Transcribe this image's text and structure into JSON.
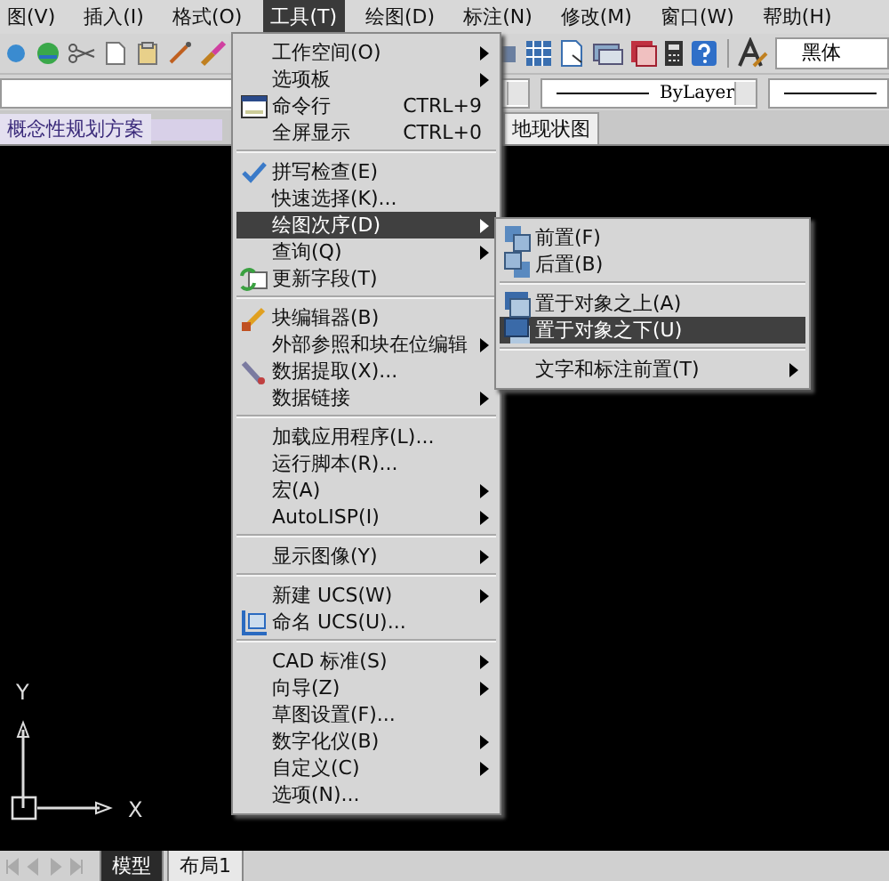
{
  "menubar": [
    {
      "label": "图(V)",
      "selected": false
    },
    {
      "label": "插入(I)",
      "selected": false
    },
    {
      "label": "格式(O)",
      "selected": false
    },
    {
      "label": "工具(T)",
      "selected": true
    },
    {
      "label": "绘图(D)",
      "selected": false
    },
    {
      "label": "标注(N)",
      "selected": false
    },
    {
      "label": "修改(M)",
      "selected": false
    },
    {
      "label": "窗口(W)",
      "selected": false
    },
    {
      "label": "帮助(H)",
      "selected": false
    }
  ],
  "font_field": {
    "value": "黑体"
  },
  "linetype_dropdown": {
    "value": "ByLayer"
  },
  "document_tabs": [
    {
      "label": "概念性规划方案",
      "selected": true
    },
    {
      "label": "地现状图",
      "selected": false
    }
  ],
  "tools_menu": [
    {
      "kind": "item",
      "label": "工作空间(O)",
      "has_submenu": true,
      "selected": false
    },
    {
      "kind": "item",
      "label": "选项板",
      "has_submenu": true,
      "selected": false
    },
    {
      "kind": "item",
      "label": "命令行",
      "shortcut": "CTRL+9",
      "has_submenu": false,
      "selected": false
    },
    {
      "kind": "item",
      "label": "全屏显示",
      "shortcut": "CTRL+0",
      "has_submenu": false,
      "selected": false
    },
    {
      "kind": "separator"
    },
    {
      "kind": "item",
      "label": "拼写检查(E)",
      "has_submenu": false,
      "selected": false
    },
    {
      "kind": "item",
      "label": "快速选择(K)...",
      "has_submenu": false,
      "selected": false
    },
    {
      "kind": "item",
      "label": "绘图次序(D)",
      "has_submenu": true,
      "selected": true
    },
    {
      "kind": "item",
      "label": "查询(Q)",
      "has_submenu": true,
      "selected": false
    },
    {
      "kind": "item",
      "label": "更新字段(T)",
      "has_submenu": false,
      "selected": false
    },
    {
      "kind": "separator"
    },
    {
      "kind": "item",
      "label": "块编辑器(B)",
      "has_submenu": false,
      "selected": false
    },
    {
      "kind": "item",
      "label": "外部参照和块在位编辑",
      "has_submenu": true,
      "selected": false
    },
    {
      "kind": "item",
      "label": "数据提取(X)...",
      "has_submenu": false,
      "selected": false
    },
    {
      "kind": "item",
      "label": "数据链接",
      "has_submenu": true,
      "selected": false
    },
    {
      "kind": "separator"
    },
    {
      "kind": "item",
      "label": "加载应用程序(L)...",
      "has_submenu": false,
      "selected": false
    },
    {
      "kind": "item",
      "label": "运行脚本(R)...",
      "has_submenu": false,
      "selected": false
    },
    {
      "kind": "item",
      "label": "宏(A)",
      "has_submenu": true,
      "selected": false
    },
    {
      "kind": "item",
      "label": "AutoLISP(I)",
      "has_submenu": true,
      "selected": false
    },
    {
      "kind": "separator"
    },
    {
      "kind": "item",
      "label": "显示图像(Y)",
      "has_submenu": true,
      "selected": false
    },
    {
      "kind": "separator"
    },
    {
      "kind": "item",
      "label": "新建 UCS(W)",
      "has_submenu": true,
      "selected": false
    },
    {
      "kind": "item",
      "label": "命名 UCS(U)...",
      "has_submenu": false,
      "selected": false
    },
    {
      "kind": "separator"
    },
    {
      "kind": "item",
      "label": "CAD 标准(S)",
      "has_submenu": true,
      "selected": false
    },
    {
      "kind": "item",
      "label": "向导(Z)",
      "has_submenu": true,
      "selected": false
    },
    {
      "kind": "item",
      "label": "草图设置(F)...",
      "has_submenu": false,
      "selected": false
    },
    {
      "kind": "item",
      "label": "数字化仪(B)",
      "has_submenu": true,
      "selected": false
    },
    {
      "kind": "item",
      "label": "自定义(C)",
      "has_submenu": true,
      "selected": false
    },
    {
      "kind": "item",
      "label": "选项(N)...",
      "has_submenu": false,
      "selected": false
    }
  ],
  "draw_order_submenu": [
    {
      "kind": "item",
      "label": "前置(F)",
      "has_submenu": false,
      "selected": false
    },
    {
      "kind": "item",
      "label": "后置(B)",
      "has_submenu": false,
      "selected": false
    },
    {
      "kind": "separator"
    },
    {
      "kind": "item",
      "label": "置于对象之上(A)",
      "has_submenu": false,
      "selected": false
    },
    {
      "kind": "item",
      "label": "置于对象之下(U)",
      "has_submenu": false,
      "selected": true
    },
    {
      "kind": "separator"
    },
    {
      "kind": "item",
      "label": "文字和标注前置(T)",
      "has_submenu": true,
      "selected": false
    }
  ],
  "ucs_icon": {
    "y_label": "Y",
    "x_label": "X"
  },
  "layout_tabs": [
    {
      "label": "模型",
      "selected": true
    },
    {
      "label": "布局1",
      "selected": false
    }
  ]
}
